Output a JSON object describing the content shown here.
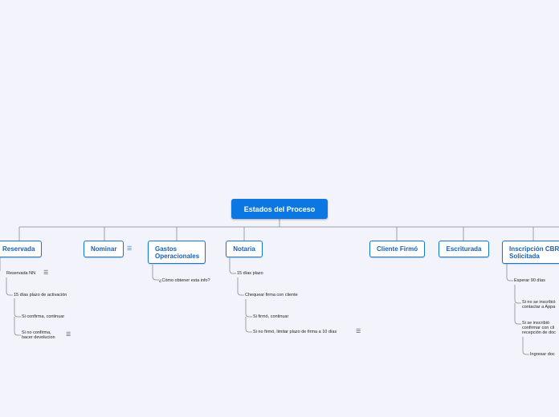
{
  "map": {
    "root": "Estados del Proceso",
    "branches": {
      "reservada": {
        "label": "Reservada",
        "children": [
          "Reservada NN",
          "15 días plazo de activación",
          "Si confirma, continuar",
          "Si no confirma,",
          "hacer devolucion"
        ]
      },
      "nominar": {
        "label": "Nominar"
      },
      "gastos": {
        "label_line1": "Gastos",
        "label_line2": "Operacionales",
        "children": [
          "¿Cómo obtener esta info?"
        ]
      },
      "notaria": {
        "label": "Notaria",
        "children": [
          "15 días plazo",
          "Chequear firma con cliente",
          "Si firmó, continuar",
          "Si no firmó, limitar plazo de firma a 10 días"
        ]
      },
      "cliente_firmo": {
        "label": "Cliente Firmó"
      },
      "escriturada": {
        "label": "Escriturada"
      },
      "inscripcion": {
        "label_line1": "Inscripción CBR",
        "label_line2": "Solicitada",
        "children": [
          "Esperar 90 días",
          "Si no se inscribió",
          "contactar a Appa",
          "Si se inscribió",
          "confirmar con cli",
          "recepción de doc",
          "Ingresar doc"
        ]
      }
    },
    "note_icon": "notes-icon"
  }
}
